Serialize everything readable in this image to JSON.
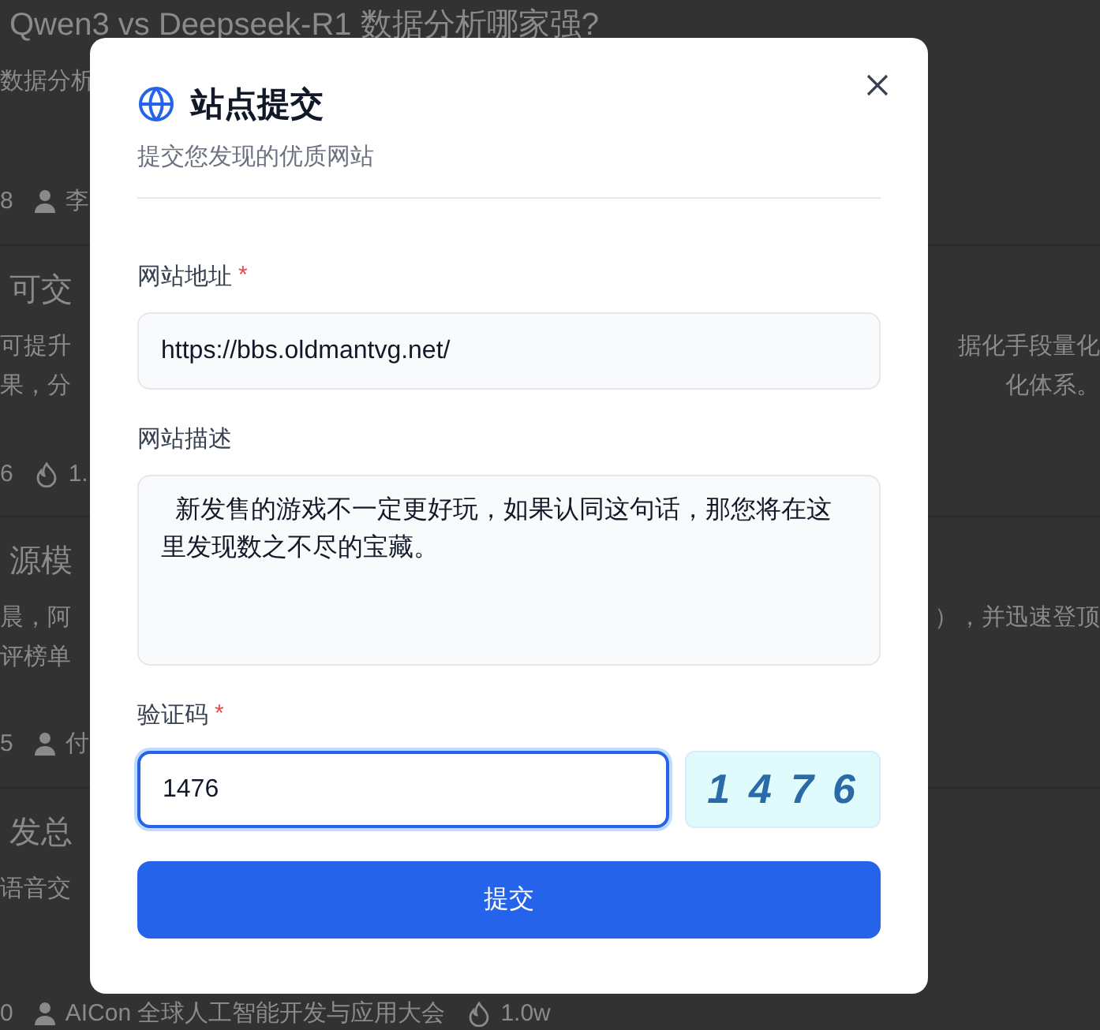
{
  "background_articles": [
    {
      "title": "Qwen3 vs Deepseek-R1 数据分析哪家强?",
      "lines": [
        {
          "left": "数据分析"
        }
      ],
      "meta": [
        {
          "kind": "count",
          "text": "8"
        },
        {
          "kind": "author",
          "text": "李"
        }
      ]
    },
    {
      "title": "可交",
      "lines": [
        {
          "left": "可提升",
          "right": "据化手段量化"
        },
        {
          "left": "果，分",
          "right": "化体系。"
        }
      ],
      "meta": [
        {
          "kind": "count",
          "text": "6"
        },
        {
          "kind": "views",
          "text": "1."
        }
      ]
    },
    {
      "title": "源模",
      "lines": [
        {
          "left": "晨，阿",
          "right": "），并迅速登顶"
        },
        {
          "left": "评榜单"
        }
      ],
      "meta": [
        {
          "kind": "count",
          "text": "5"
        },
        {
          "kind": "author",
          "text": "付"
        }
      ]
    },
    {
      "title": "发总",
      "lines": [
        {
          "left": "语音交"
        }
      ],
      "meta": [
        {
          "kind": "count",
          "text": "0"
        },
        {
          "kind": "author",
          "text": "AICon 全球人工智能开发与应用大会"
        },
        {
          "kind": "views",
          "text": "1.0w"
        }
      ]
    }
  ],
  "dialog": {
    "title": "站点提交",
    "subtitle": "提交您发现的优质网站",
    "required_mark": "*",
    "fields": [
      {
        "kind": "input",
        "label": "网站地址",
        "required": true,
        "value": "https://bbs.oldmantvg.net/",
        "focused": false
      },
      {
        "kind": "textarea",
        "label": "网站描述",
        "required": false,
        "value": "  新发售的游戏不一定更好玩，如果认同这句话，那您将在这里发现数之不尽的宝藏。",
        "focused": false
      },
      {
        "kind": "captcha",
        "label": "验证码",
        "required": true,
        "value": "1476",
        "focused": true,
        "captcha": "1476"
      }
    ],
    "submit": "提交"
  }
}
